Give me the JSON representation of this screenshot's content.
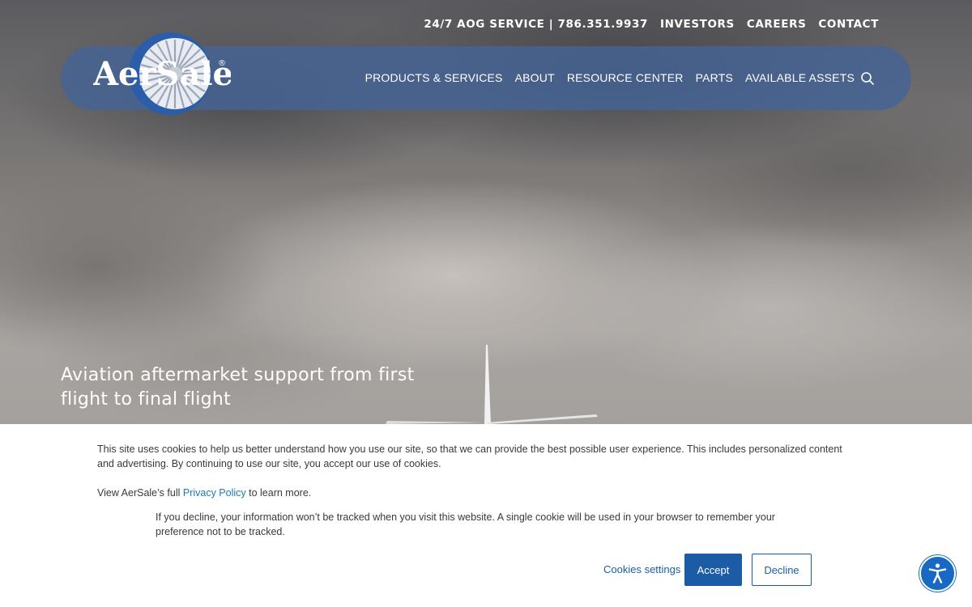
{
  "header": {
    "utility_links": [
      {
        "label": "24/7 AOG SERVICE | 786.351.9937"
      },
      {
        "label": "INVESTORS"
      },
      {
        "label": "CAREERS"
      },
      {
        "label": "CONTACT"
      }
    ],
    "logo_text": "AerSale",
    "logo_mark": "®",
    "main_nav": [
      {
        "label": "PRODUCTS & SERVICES"
      },
      {
        "label": "ABOUT"
      },
      {
        "label": "RESOURCE CENTER"
      },
      {
        "label": "PARTS"
      },
      {
        "label": "AVAILABLE ASSETS"
      }
    ],
    "search_icon": "search-icon"
  },
  "hero": {
    "tagline": "Aviation aftermarket support from first flight to final flight"
  },
  "cookie_banner": {
    "text": "This site uses cookies to help us better understand how you use our site, so that we can provide the best possible user experience.  This includes personalized content and advertising. By continuing to use our site, you accept our use of cookies.",
    "privacy_prefix": "View AerSale’s full ",
    "privacy_link": "Privacy Policy",
    "privacy_suffix": " to learn more.",
    "decline_note": "If you decline, your information won’t be tracked when you visit this website. A single cookie will be used in your browser to remember your preference not to be tracked.",
    "settings_label": "Cookies settings",
    "accept_label": "Accept",
    "decline_label": "Decline"
  },
  "accessibility": {
    "icon": "accessibility-icon"
  },
  "colors": {
    "nav_bar": "#44649a",
    "accept_button": "#1c5ba6",
    "link": "#1b7ab8",
    "accessibility_button": "#1769c4"
  }
}
